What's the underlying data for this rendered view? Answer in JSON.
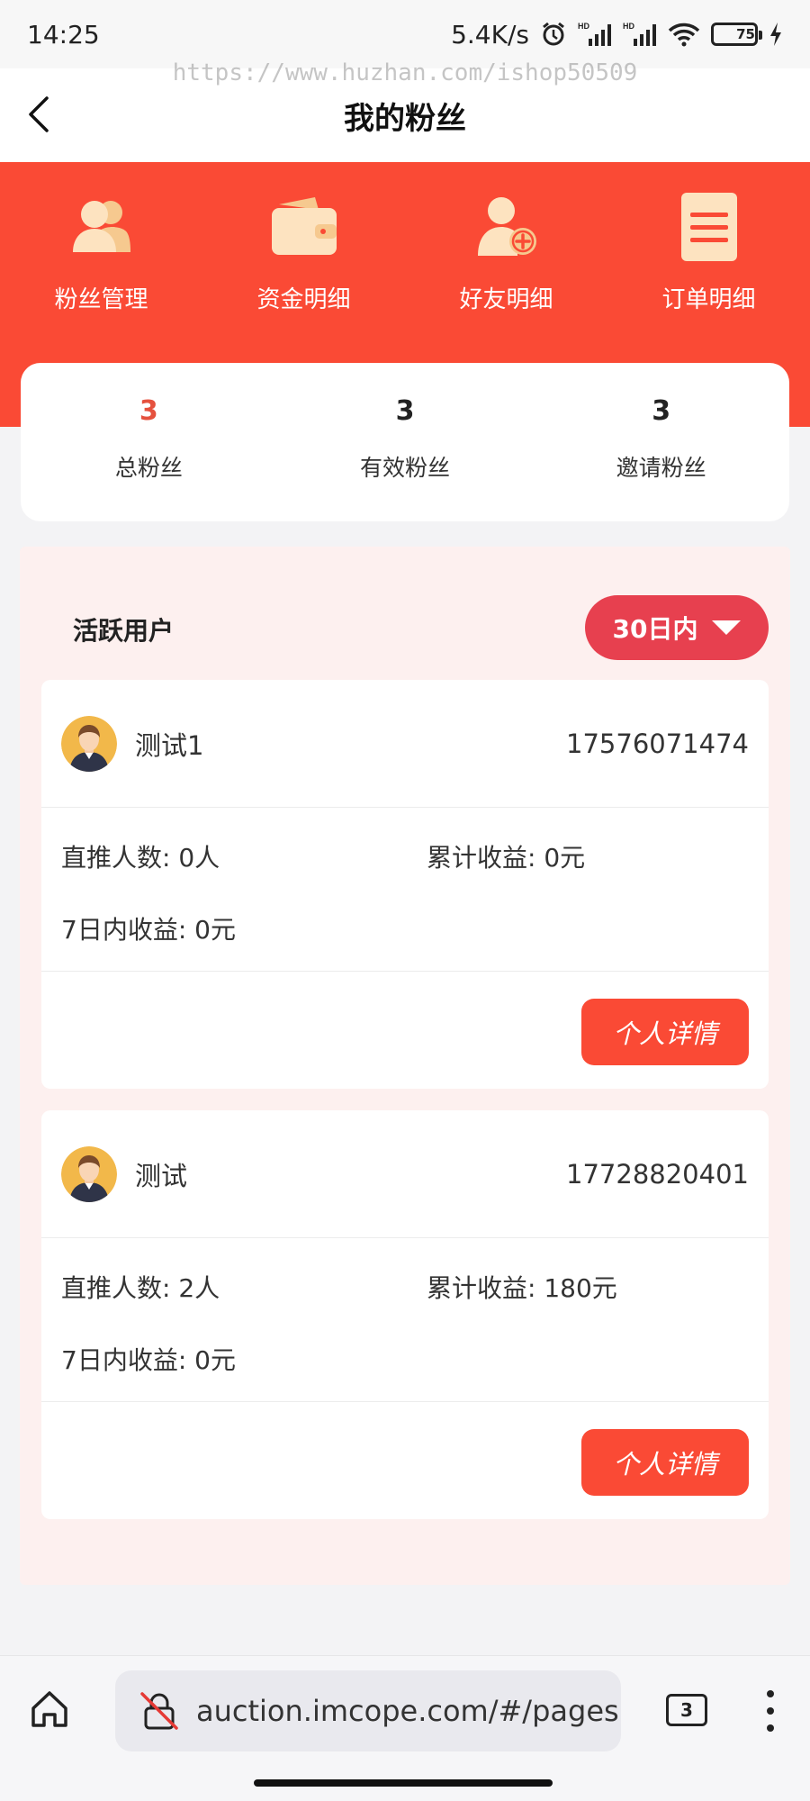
{
  "status_bar": {
    "time": "14:25",
    "net_speed": "5.4K/s",
    "battery": "75"
  },
  "watermark": "https://www.huzhan.com/ishop50509",
  "header": {
    "title": "我的粉丝"
  },
  "menu": [
    {
      "label": "粉丝管理",
      "icon": "people-icon"
    },
    {
      "label": "资金明细",
      "icon": "wallet-icon"
    },
    {
      "label": "好友明细",
      "icon": "add-friend-icon"
    },
    {
      "label": "订单明细",
      "icon": "list-icon"
    }
  ],
  "stats": [
    {
      "value": "3",
      "label": "总粉丝"
    },
    {
      "value": "3",
      "label": "有效粉丝"
    },
    {
      "value": "3",
      "label": "邀请粉丝"
    }
  ],
  "active": {
    "title": "活跃用户",
    "range": "30日内",
    "fans": [
      {
        "name": "测试1",
        "phone": "17576071474",
        "direct": "直推人数: 0人",
        "total": "累计收益: 0元",
        "week": "7日内收益: 0元",
        "button": "个人详情"
      },
      {
        "name": "测试",
        "phone": "17728820401",
        "direct": "直推人数: 2人",
        "total": "累计收益: 180元",
        "week": "7日内收益: 0元",
        "button": "个人详情"
      }
    ]
  },
  "browser": {
    "url": "auction.imcope.com/#/pages",
    "tab_count": "3"
  },
  "colors": {
    "accent": "#fa4a35",
    "range_button": "#e7404f",
    "icon_cream": "#fde3c0"
  }
}
